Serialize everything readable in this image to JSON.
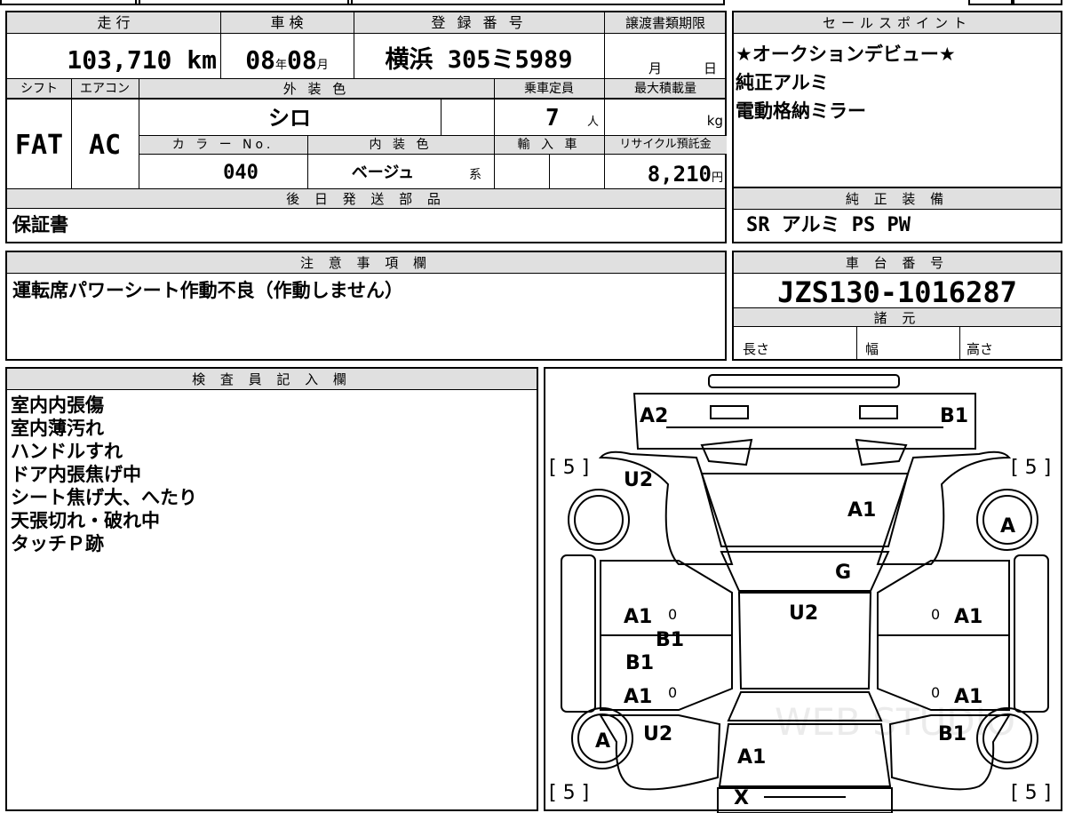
{
  "top_table": {
    "mileage_label": "走 行",
    "mileage": "103,710",
    "mileage_unit": "km",
    "inspection_label": "車 検",
    "inspection_year": "08",
    "year_unit": "年",
    "inspection_month": "08",
    "month_unit": "月",
    "registration_label": "登 録 番 号",
    "registration": "横浜 305ミ5989",
    "transfer_label": "譲渡書類期限",
    "transfer_month_unit": "月",
    "transfer_day_unit": "日",
    "shift_label": "シフト",
    "shift": "FAT",
    "ac_label": "エアコン",
    "ac": "AC",
    "exterior_color_label": "外 装 色",
    "exterior_color": "シロ",
    "capacity_label": "乗車定員",
    "capacity": "7",
    "capacity_unit": "人",
    "max_load_label": "最大積載量",
    "max_load_unit": "kg",
    "color_no_label": "カ ラ ー No.",
    "color_no": "040",
    "interior_color_label": "内 装 色",
    "interior_color": "ベージュ",
    "interior_color_suffix": "系",
    "import_label": "輸 入 車",
    "recycle_label": "リサイクル預託金",
    "recycle_fee": "8,210",
    "recycle_unit": "円",
    "later_parts_label": "後 日 発 送 部 品",
    "later_parts": "保証書"
  },
  "sales_points": {
    "label": "セールスポイント",
    "lines": [
      "★オークションデビュー★",
      "純正アルミ",
      "電動格納ミラー"
    ]
  },
  "factory_equipment": {
    "label": "純 正 装 備",
    "value": "SR アルミ PS PW"
  },
  "notes": {
    "label": "注 意 事 項 欄",
    "text": "運転席パワーシート作動不良（作動しません）"
  },
  "chassis": {
    "label": "車 台 番 号",
    "number": "JZS130-1016287"
  },
  "specs": {
    "label": "諸 元",
    "length_label": "長さ",
    "width_label": "幅",
    "height_label": "高さ"
  },
  "inspector": {
    "label": "検 査 員 記 入 欄",
    "lines": [
      "室内内張傷",
      "室内薄汚れ",
      "ハンドルすれ",
      "ドア内張焦げ中",
      "シート焦げ大、へたり",
      "天張切れ・破れ中",
      "タッチＰ跡"
    ]
  },
  "diagram": {
    "tire_left": "[ 5 ]",
    "tire_right": "[ 5 ]",
    "marks": {
      "front_bumper_left": "A2",
      "front_bumper_right": "B1",
      "left_front_fender": "U2",
      "hood": "A1",
      "right_front_wheel": "A",
      "windshield": "G",
      "roof": "U2",
      "left_front_door": "A1",
      "left_front_door_zero": "0",
      "left_pillar": "B1",
      "left_rear_door_upper": "B1",
      "left_rear_door": "A1",
      "left_rear_door_zero": "0",
      "right_front_door_zero": "0",
      "right_front_door": "A1",
      "right_rear_door_zero": "0",
      "right_rear_door": "A1",
      "left_rear_wheel": "A",
      "left_rear_fender": "U2",
      "trunk": "A1",
      "right_rear_fender": "B1",
      "rear_bumper": "X"
    },
    "watermark": "WEB STUDIO"
  }
}
